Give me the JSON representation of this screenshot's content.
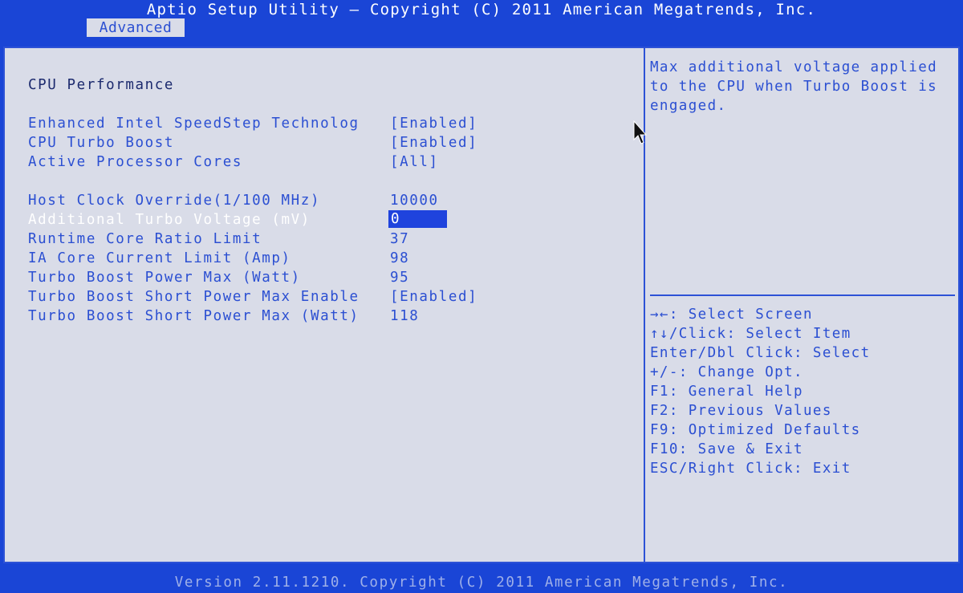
{
  "header": {
    "title": "Aptio Setup Utility – Copyright (C) 2011 American Megatrends, Inc.",
    "tab": "Advanced"
  },
  "section_title": "CPU Performance",
  "settings": [
    {
      "label": "Enhanced Intel SpeedStep Technolog",
      "value": "[Enabled]"
    },
    {
      "label": "CPU Turbo Boost",
      "value": "[Enabled]"
    },
    {
      "label": "Active Processor Cores",
      "value": "[All]"
    },
    {
      "label": "Host Clock Override(1/100 MHz)",
      "value": "10000"
    },
    {
      "label": "Additional Turbo Voltage (mV)",
      "value": "0"
    },
    {
      "label": "Runtime Core Ratio Limit",
      "value": "37"
    },
    {
      "label": "IA Core Current Limit (Amp)",
      "value": "98"
    },
    {
      "label": "Turbo Boost Power Max (Watt)",
      "value": "95"
    },
    {
      "label": "Turbo Boost Short Power Max Enable",
      "value": "[Enabled]"
    },
    {
      "label": "Turbo Boost Short Power Max (Watt)",
      "value": "118"
    }
  ],
  "help_text": "Max additional voltage applied to the CPU when Turbo Boost is engaged.",
  "key_help": [
    "→←: Select Screen",
    "↑↓/Click: Select Item",
    "Enter/Dbl Click: Select",
    "+/-: Change Opt.",
    "F1: General Help",
    "F2: Previous Values",
    "F9: Optimized Defaults",
    "F10: Save & Exit",
    "ESC/Right Click: Exit"
  ],
  "footer": "Version 2.11.1210. Copyright (C) 2011 American Megatrends, Inc.",
  "colors": {
    "frame_blue": "#1a45d6",
    "panel_gray": "#d9dce8",
    "item_blue": "#2b4fd2",
    "selection": "#1f43dd"
  }
}
